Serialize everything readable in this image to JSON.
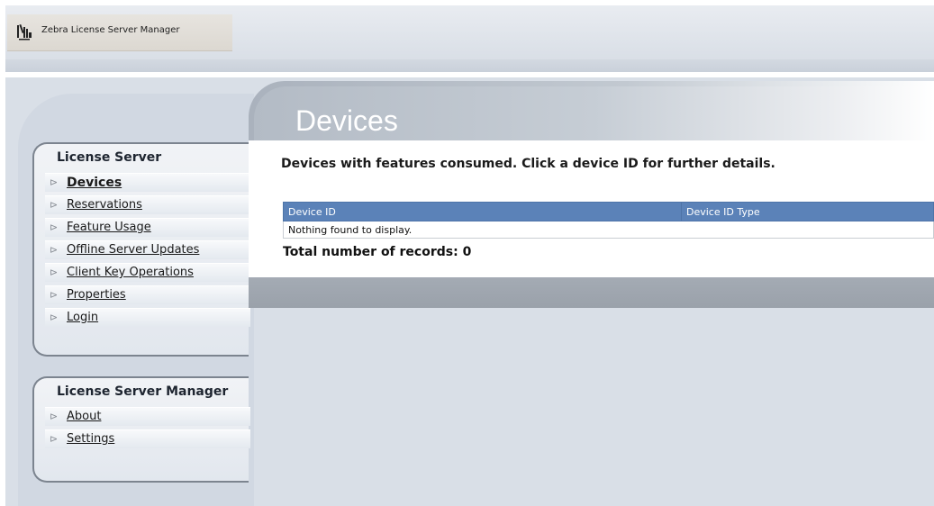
{
  "header": {
    "app_title": "Zebra License Server Manager",
    "logo_icon": "zebra-logo-icon"
  },
  "page": {
    "title": "Devices",
    "description": "Devices with features consumed. Click a device ID for further details."
  },
  "sidebar": {
    "license_server": {
      "title": "License Server",
      "items": [
        {
          "label": "Devices",
          "active": true
        },
        {
          "label": "Reservations",
          "active": false
        },
        {
          "label": "Feature Usage",
          "active": false
        },
        {
          "label": "Offline Server Updates",
          "active": false
        },
        {
          "label": "Client Key Operations",
          "active": false
        },
        {
          "label": "Properties",
          "active": false
        },
        {
          "label": "Login",
          "active": false
        }
      ]
    },
    "license_server_manager": {
      "title": "License Server Manager",
      "items": [
        {
          "label": "About",
          "active": false
        },
        {
          "label": "Settings",
          "active": false
        }
      ]
    }
  },
  "table": {
    "columns": [
      "Device ID",
      "Device ID Type"
    ],
    "empty_message": "Nothing found to display.",
    "total_label": "Total number of records: 0"
  },
  "colors": {
    "table_header": "#5b82b8",
    "page_background": "#d9dfe7"
  }
}
